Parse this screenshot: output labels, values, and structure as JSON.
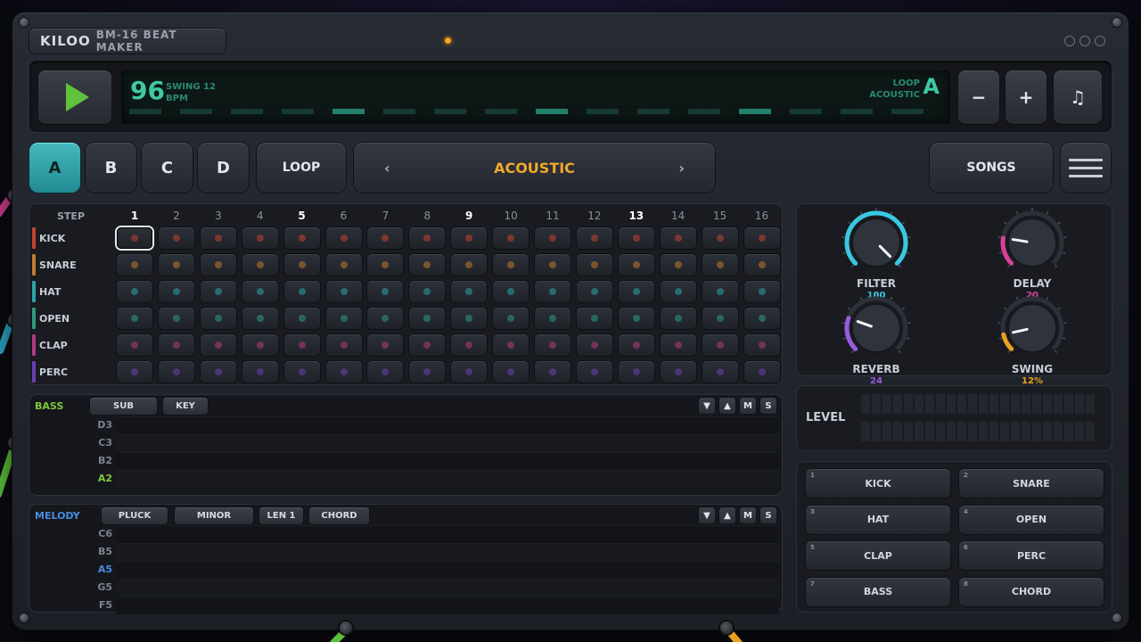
{
  "header": {
    "brand": "KILOO",
    "model": "BM-16  BEAT MAKER"
  },
  "transport": {
    "tempo": "96",
    "swing": "SWING 12",
    "bpm_unit": "BPM",
    "loop_label": "LOOP",
    "pattern_name": "ACOUSTIC",
    "loop_letter": "A",
    "lcd_active_steps": [
      5,
      9,
      13
    ],
    "minus_label": "−",
    "plus_label": "+",
    "note_glyph": "♫"
  },
  "patterns": {
    "buttons": [
      "A",
      "B",
      "C",
      "D"
    ],
    "active": "A",
    "loop_label": "LOOP",
    "kit_name": "ACOUSTIC",
    "prev_arrow": "‹",
    "next_arrow": "›",
    "songs_label": "SONGS"
  },
  "sequencer": {
    "step_header": "STEP",
    "steps": [
      "1",
      "2",
      "3",
      "4",
      "5",
      "6",
      "7",
      "8",
      "9",
      "10",
      "11",
      "12",
      "13",
      "14",
      "15",
      "16"
    ],
    "beat_steps": [
      "1",
      "5",
      "9",
      "13"
    ],
    "selected_step": 1,
    "tracks": [
      {
        "name": "KICK",
        "color": "#c0452e"
      },
      {
        "name": "SNARE",
        "color": "#c07a2e"
      },
      {
        "name": "HAT",
        "color": "#2aa3a8"
      },
      {
        "name": "OPEN",
        "color": "#2f9a7e"
      },
      {
        "name": "CLAP",
        "color": "#b03a82"
      },
      {
        "name": "PERC",
        "color": "#6a3fb0"
      }
    ]
  },
  "bass": {
    "title": "BASS",
    "title_color": "#7ec83a",
    "chips": [
      "SUB",
      "KEY"
    ],
    "controls": [
      "▼",
      "▲",
      "M",
      "S"
    ],
    "notes": [
      "D3",
      "C3",
      "B2",
      "A2"
    ],
    "root": "A2"
  },
  "melody": {
    "title": "MELODY",
    "title_color": "#4a8ee0",
    "chips": [
      "PLUCK",
      "MINOR",
      "LEN 1",
      "CHORD"
    ],
    "controls": [
      "▼",
      "▲",
      "M",
      "S"
    ],
    "notes": [
      "C6",
      "B5",
      "A5",
      "G5",
      "F5"
    ],
    "root": "A5"
  },
  "fx": {
    "knobs": [
      {
        "name": "FILTER",
        "value": "100",
        "color": "#39c8e0",
        "level": 1.0
      },
      {
        "name": "DELAY",
        "value": "20",
        "color": "#d8409a",
        "level": 0.2
      },
      {
        "name": "REVERB",
        "value": "24",
        "color": "#9a5ae0",
        "level": 0.24
      },
      {
        "name": "SWING",
        "value": "12%",
        "color": "#e8a020",
        "level": 0.12
      }
    ]
  },
  "level": {
    "label": "LEVEL"
  },
  "sounds": {
    "buttons": [
      {
        "num": "1",
        "label": "KICK"
      },
      {
        "num": "2",
        "label": "SNARE"
      },
      {
        "num": "3",
        "label": "HAT"
      },
      {
        "num": "4",
        "label": "OPEN"
      },
      {
        "num": "5",
        "label": "CLAP"
      },
      {
        "num": "6",
        "label": "PERC"
      },
      {
        "num": "7",
        "label": "BASS"
      },
      {
        "num": "8",
        "label": "CHORD"
      }
    ]
  }
}
